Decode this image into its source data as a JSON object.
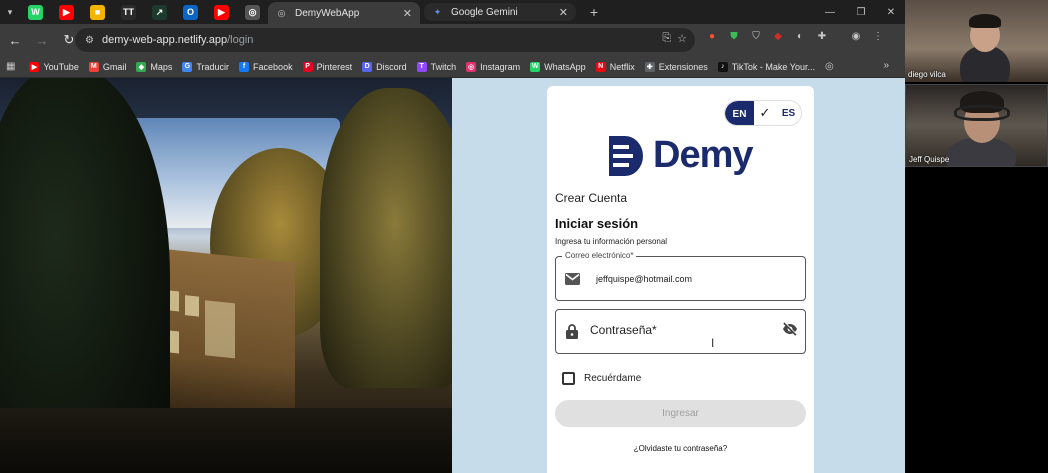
{
  "browser": {
    "pinned_tabs": [
      {
        "name": "whatsapp-pinned-tab",
        "color": "#25d366",
        "glyph": "W"
      },
      {
        "name": "youtube-pinned-tab",
        "color": "#ff0000",
        "glyph": "▶"
      },
      {
        "name": "app-pinned-tab",
        "color": "#f4b400",
        "glyph": "■"
      },
      {
        "name": "tt-pinned-tab",
        "color": "#2b2b2b",
        "glyph": "TT"
      },
      {
        "name": "vercel-pinned-tab",
        "color": "#1e3a2e",
        "glyph": "↗"
      },
      {
        "name": "outlook-pinned-tab",
        "color": "#0a66c2",
        "glyph": "O"
      },
      {
        "name": "youtube-pinned-tab-2",
        "color": "#ff0000",
        "glyph": "▶"
      },
      {
        "name": "globe-pinned-tab",
        "color": "#555555",
        "glyph": "◎"
      }
    ],
    "tabs": [
      {
        "title": "DemyWebApp",
        "active": true
      },
      {
        "title": "Google Gemini",
        "active": false
      }
    ],
    "new_tab": "+",
    "window_controls": {
      "minimize": "—",
      "restore": "❐",
      "close": "✕"
    },
    "url_host": "demy-web-app.netlify.app",
    "url_path": "/login",
    "bookmarks": [
      {
        "label": "YouTube",
        "color": "#ff0000",
        "glyph": "▶"
      },
      {
        "label": "Gmail",
        "color": "#ea4335",
        "glyph": "M"
      },
      {
        "label": "Maps",
        "color": "#34a853",
        "glyph": "◆"
      },
      {
        "label": "Traducir",
        "color": "#4285f4",
        "glyph": "G"
      },
      {
        "label": "Facebook",
        "color": "#1877f2",
        "glyph": "f"
      },
      {
        "label": "Pinterest",
        "color": "#e60023",
        "glyph": "P"
      },
      {
        "label": "Discord",
        "color": "#5865f2",
        "glyph": "D"
      },
      {
        "label": "Twitch",
        "color": "#9146ff",
        "glyph": "T"
      },
      {
        "label": "Instagram",
        "color": "#e1306c",
        "glyph": "◎"
      },
      {
        "label": "WhatsApp",
        "color": "#25d366",
        "glyph": "W"
      },
      {
        "label": "Netflix",
        "color": "#e50914",
        "glyph": "N"
      },
      {
        "label": "Extensiones",
        "color": "#5f6368",
        "glyph": "✚"
      },
      {
        "label": "TikTok - Make Your...",
        "color": "#111111",
        "glyph": "♪"
      }
    ]
  },
  "login": {
    "lang_en": "EN",
    "lang_es": "ES",
    "brand": "Demy",
    "create_account": "Crear Cuenta",
    "title": "Iniciar sesión",
    "subtitle": "Ingresa tu información personal",
    "email_label": "Correo electrónico*",
    "email_value": "jeffquispe@hotmail.com",
    "password_placeholder": "Contraseña*",
    "remember_label": "Recuérdame",
    "submit_label": "Ingresar",
    "forgot_label": "¿Olvidaste tu contraseña?",
    "brand_color": "#1a2a6c"
  },
  "meeting": {
    "participants": [
      {
        "name": "diego vilca"
      },
      {
        "name": "Jeff Quispe"
      }
    ]
  }
}
